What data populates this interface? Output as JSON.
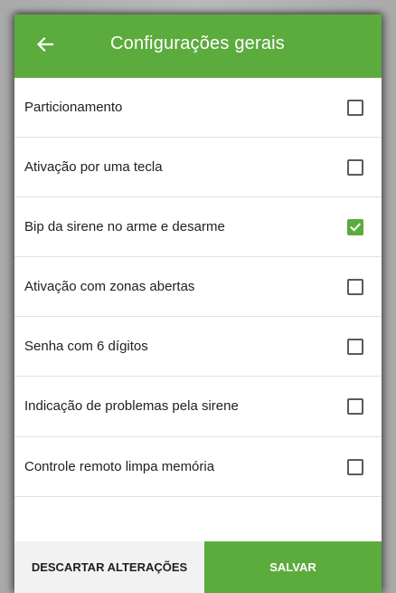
{
  "appbar": {
    "title": "Configurações gerais",
    "back_icon": "arrow-left-icon",
    "color": "#5cab3d"
  },
  "settings": [
    {
      "label": "Particionamento",
      "checked": false
    },
    {
      "label": "Ativação por uma tecla",
      "checked": false
    },
    {
      "label": "Bip da sirene no arme e desarme",
      "checked": true
    },
    {
      "label": "Ativação com zonas abertas",
      "checked": false
    },
    {
      "label": "Senha com 6 dígitos",
      "checked": false
    },
    {
      "label": "Indicação de problemas pela sirene",
      "checked": false
    },
    {
      "label": "Controle remoto limpa memória",
      "checked": false
    }
  ],
  "footer": {
    "discard_label": "DESCARTAR ALTERAÇÕES",
    "save_label": "SALVAR"
  }
}
